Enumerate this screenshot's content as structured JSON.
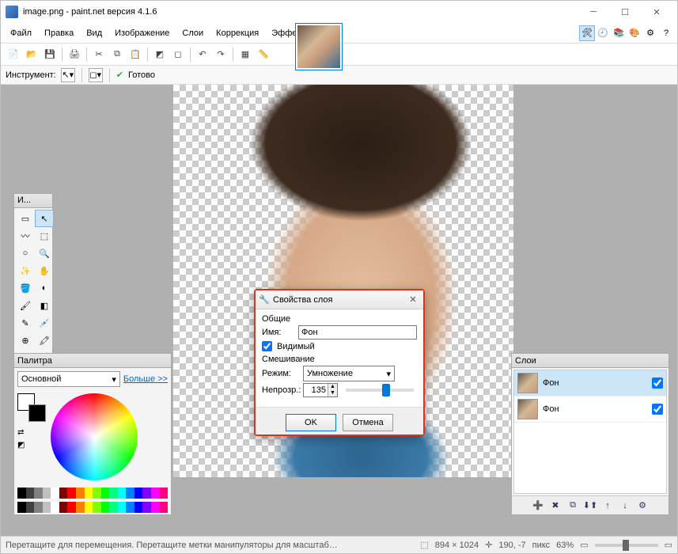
{
  "title": "image.png - paint.net версия 4.1.6",
  "menu": [
    "Файл",
    "Правка",
    "Вид",
    "Изображение",
    "Слои",
    "Коррекция",
    "Эффекты"
  ],
  "toolrow": {
    "label": "Инструмент:",
    "status": "Готово"
  },
  "tools_panel_title": "И...",
  "palette": {
    "title": "Палитра",
    "dropdown": "Основной",
    "more": "Больше >>"
  },
  "layers": {
    "title": "Слои",
    "items": [
      {
        "name": "Фон",
        "visible": true,
        "selected": true
      },
      {
        "name": "Фон",
        "visible": true,
        "selected": false
      }
    ]
  },
  "dialog": {
    "title": "Свойства слоя",
    "group_general": "Общие",
    "label_name": "Имя:",
    "name_value": "Фон",
    "visible_label": "Видимый",
    "visible_checked": true,
    "group_blend": "Смешивание",
    "label_mode": "Режим:",
    "mode_value": "Умножение",
    "label_opacity": "Непрозр.:",
    "opacity_value": "135",
    "opacity_percent": 53,
    "ok": "OK",
    "cancel": "Отмена"
  },
  "status": {
    "hint": "Перетащите для перемещения. Перетащите метки манипуляторы для масштабирования и поворота. Удерживайте Shift для ограничен...",
    "dims": "894 × 1024",
    "cursor": "190, -7",
    "units": "пикс",
    "zoom": "63%"
  },
  "colors_strip": [
    "#000",
    "#404040",
    "#808080",
    "#c0c0c0",
    "#fff",
    "#800000",
    "#f00",
    "#ff8000",
    "#ff0",
    "#80ff00",
    "#0f0",
    "#00ff80",
    "#0ff",
    "#0080ff",
    "#00f",
    "#8000ff",
    "#f0f",
    "#ff0080"
  ]
}
